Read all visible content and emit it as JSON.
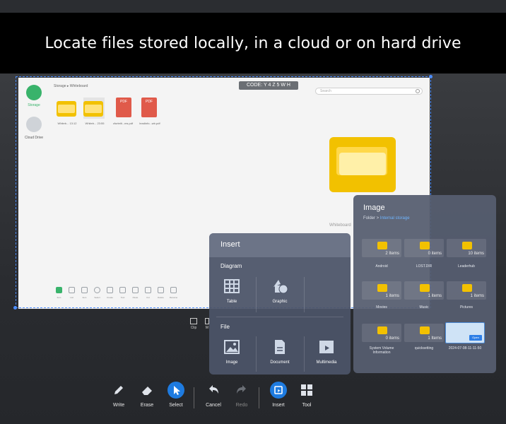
{
  "banner": {
    "text": "Locate files stored locally, in a cloud or on hard drive"
  },
  "whiteboard": {
    "breadcrumb": "Storage  ▸  Whiteboard",
    "code": "CODE: Y 4 Z 5 W H",
    "search_placeholder": "Search",
    "sidebar": [
      {
        "label": "Storage",
        "color": "#39b36b"
      },
      {
        "label": "Cloud Drive",
        "color": "#cfd3d8"
      }
    ],
    "files": [
      {
        "type": "folder",
        "label": "Whiteb... 13:12"
      },
      {
        "type": "folder",
        "label": "Whiteb... 23:55"
      },
      {
        "type": "pdf",
        "label": "cfurteiti...ms.pdf"
      },
      {
        "type": "pdf",
        "label": "leadinfo...wb.pdf"
      }
    ],
    "caption": "Whiteboard",
    "toolbar": [
      "Item",
      "List",
      "Item",
      "Select",
      "Create",
      "Tool",
      "Paste",
      "Cut",
      "Delete",
      "Rename"
    ],
    "clip_label": "Clip",
    "m_label": "M"
  },
  "insert": {
    "title": "Insert",
    "diagram_label": "Diagram",
    "diagram_items": [
      "Table",
      "Graphic"
    ],
    "file_label": "File",
    "file_items": [
      "Image",
      "Document",
      "Multimedia"
    ]
  },
  "image_panel": {
    "title": "Image",
    "path_prefix": "Folder > ",
    "path_current": "Internal storage",
    "cells": [
      {
        "name": "Android",
        "count": "2 Items"
      },
      {
        "name": "LOST.DIR",
        "count": "0 items"
      },
      {
        "name": "Leaderhub",
        "count": "10 items"
      },
      {
        "name": "Movies",
        "count": "1 items"
      },
      {
        "name": "Music",
        "count": "1 items"
      },
      {
        "name": "Pictures",
        "count": "1 items"
      },
      {
        "name": "System Volume Information",
        "count": "0 items"
      },
      {
        "name": "quicksetting",
        "count": "1 Items"
      },
      {
        "name": "2024-07-08-11-11-50",
        "count": ""
      }
    ],
    "open_label": "Open"
  },
  "bottom_bar": [
    {
      "label": "Write",
      "icon": "pen-icon"
    },
    {
      "label": "Erase",
      "icon": "eraser-icon"
    },
    {
      "label": "Select",
      "icon": "select-icon"
    },
    {
      "label": "Cancel",
      "icon": "undo-icon"
    },
    {
      "label": "Redo",
      "icon": "redo-icon"
    },
    {
      "label": "Insert",
      "icon": "insert-icon"
    },
    {
      "label": "Tool",
      "icon": "tool-icon"
    }
  ]
}
